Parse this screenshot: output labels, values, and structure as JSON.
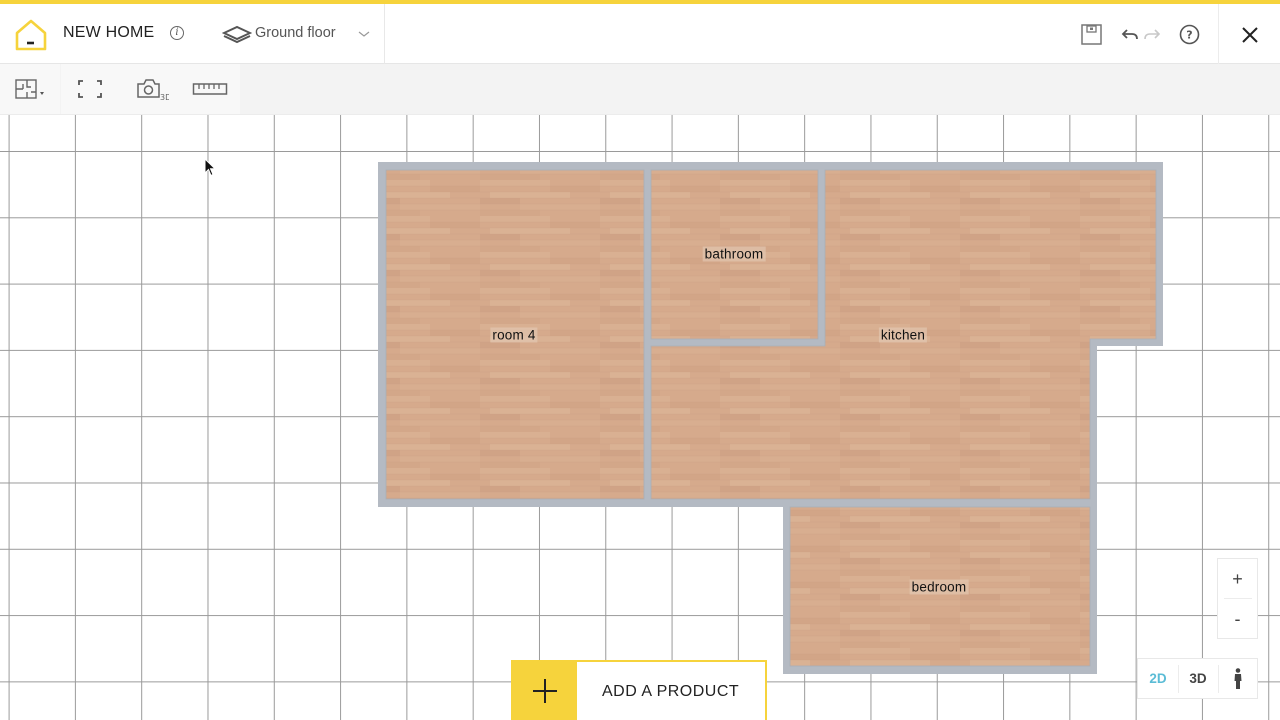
{
  "colors": {
    "brand": "#f6d33c",
    "active_view": "#5bbcd6",
    "wall": "#b4bac3",
    "floor": "#d4a98c",
    "grid": "#9a9a9a"
  },
  "header": {
    "logo_icon": "house-logo-icon",
    "title": "NEW HOME",
    "info_icon_glyph": "i",
    "floor_selector": {
      "icon": "layers-icon",
      "selected": "Ground floor",
      "chevron": "chevron-down-icon"
    },
    "actions": [
      {
        "name": "save",
        "icon": "floppy-disk-icon",
        "enabled": true
      },
      {
        "name": "undo",
        "icon": "undo-arrow-icon",
        "enabled": true
      },
      {
        "name": "redo",
        "icon": "redo-arrow-icon",
        "enabled": false
      },
      {
        "name": "help",
        "icon": "help-circle-icon",
        "glyph": "?"
      },
      {
        "name": "close",
        "icon": "close-icon"
      }
    ]
  },
  "toolbar": {
    "tools": [
      {
        "name": "floor-plan-menu",
        "icon": "floor-plan-icon"
      },
      {
        "name": "fullscreen",
        "icon": "fullscreen-icon"
      },
      {
        "name": "3d-snapshot",
        "icon": "camera-3d-icon",
        "badge": "3D"
      },
      {
        "name": "measure",
        "icon": "ruler-icon"
      }
    ]
  },
  "plan": {
    "rooms": [
      {
        "name": "room 4"
      },
      {
        "name": "bathroom"
      },
      {
        "name": "kitchen"
      },
      {
        "name": "bedroom"
      }
    ]
  },
  "add_product": {
    "icon": "plus-icon",
    "label": "ADD A PRODUCT"
  },
  "zoom_controls": {
    "zoom_in": "+",
    "zoom_out": "-"
  },
  "view_modes": {
    "options": [
      "2D",
      "3D"
    ],
    "walk_icon": "person-icon",
    "active": "2D"
  }
}
